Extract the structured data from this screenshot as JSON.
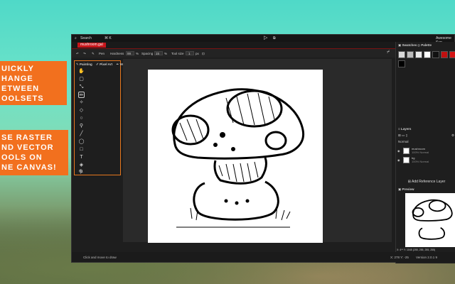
{
  "promo": {
    "top_lines": [
      "UICKLY",
      "HANGE",
      "ETWEEN",
      "OOLSETS"
    ],
    "bottom_lines": [
      "SE RASTER",
      "ND VECTOR",
      "OOLS ON",
      "NE CANVAS!"
    ]
  },
  "titlebar": {
    "search": "Search",
    "shortcut": "⌘ K",
    "menu": "Awesome Sup"
  },
  "document_tab": "mushroom.gal",
  "toolbar": {
    "pen_label": "Pen",
    "hardness_label": "Hardness",
    "hardness_value": "99",
    "spacing_label": "Spacing",
    "spacing_value": "15",
    "tool_size_label": "Tool size",
    "tool_size_value": "1",
    "unit": "px",
    "percent": "%"
  },
  "modes": {
    "painting": "Painting",
    "pixel_art": "Pixel Art",
    "vector": "Vector"
  },
  "right_panel": {
    "swatches_tab": "Swatches",
    "palette_tab": "Palette",
    "swatch_colors": [
      "#d8d8d8",
      "#bbbbbb",
      "#e9e9e9",
      "#ffffff",
      "#111111",
      "#c01010",
      "#d41414",
      "#222222",
      "#000000"
    ],
    "layers_tab": "Layers",
    "blend_mode": "Normal",
    "layers": [
      {
        "name": "mushroom",
        "detail": "100% Normal"
      },
      {
        "name": "bg",
        "detail": "100% Normal"
      }
    ],
    "add_reference": "Add Reference Layer",
    "preview_tab": "Preview"
  },
  "status": {
    "hint": "Click and move to draw",
    "coords": "X: 278 Y: -25",
    "version": "Version 2.0.1 9",
    "pixel_info": "X: 4** Y: 1045  (255, 255, 255, 255)"
  },
  "colors": {
    "accent": "#c8161b",
    "promo": "#f2701e"
  }
}
